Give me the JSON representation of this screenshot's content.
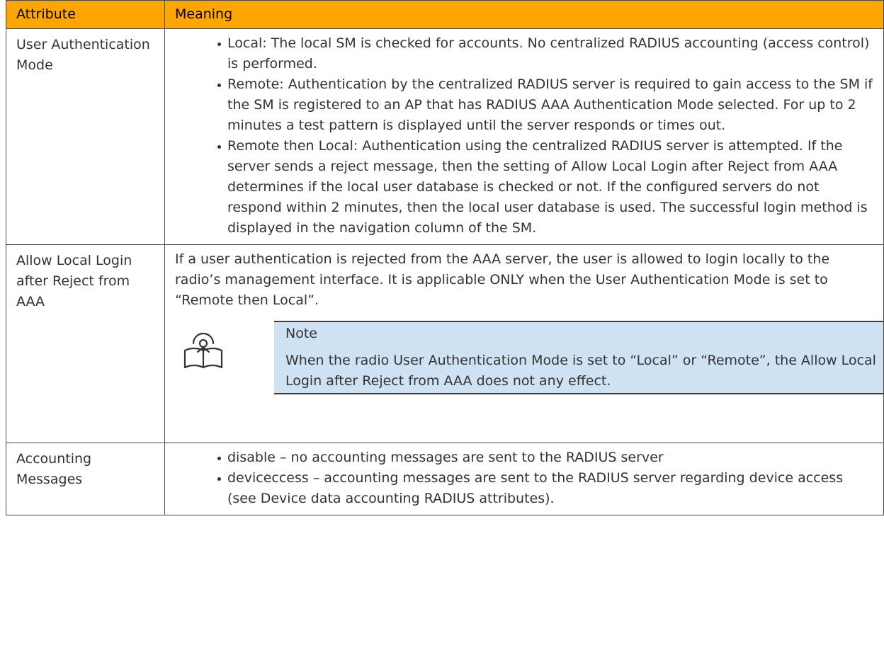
{
  "table": {
    "headers": [
      "Attribute",
      "Meaning"
    ],
    "rows": [
      {
        "attribute": "User Authentication Mode",
        "bullets": [
          "Local: The local SM is checked for accounts. No centralized RADIUS accounting (access control) is performed.",
          "Remote: Authentication by the centralized RADIUS server is required to gain access to the SM if the SM is registered to an AP that has RADIUS AAA Authentication Mode selected. For up to 2 minutes a test pattern is displayed until the server responds or times out.",
          "Remote then Local: Authentication using the centralized RADIUS server is attempted. If the server sends a reject message, then the setting of Allow Local Login after Reject from AAA determines if the local user database is checked or not. If the configured servers do not respond within 2 minutes, then the local user database is used. The successful login method is displayed in the navigation column of the SM."
        ]
      },
      {
        "attribute": "Allow Local Login after Reject from AAA",
        "text": "If a user authentication is rejected from the AAA server, the user is allowed to login locally to the radio’s management interface. It is applicable ONLY when the User Authentication Mode is set to “Remote then Local”.",
        "note": {
          "icon": "note-book-icon",
          "title": "Note",
          "text": "When the radio User Authentication Mode is set to “Local” or “Remote”, the Allow Local Login after Reject from AAA does not any effect."
        }
      },
      {
        "attribute": "Accounting Messages",
        "bullets": [
          "disable – no accounting messages are sent to the RADIUS server",
          "deviceccess – accounting messages are sent to the RADIUS server regarding device access (see Device data accounting RADIUS attributes)."
        ]
      }
    ]
  },
  "colors": {
    "header_bg": "#ffa500",
    "note_bg": "#cfe2f3",
    "border": "#4a4a4a",
    "text": "#333333"
  }
}
